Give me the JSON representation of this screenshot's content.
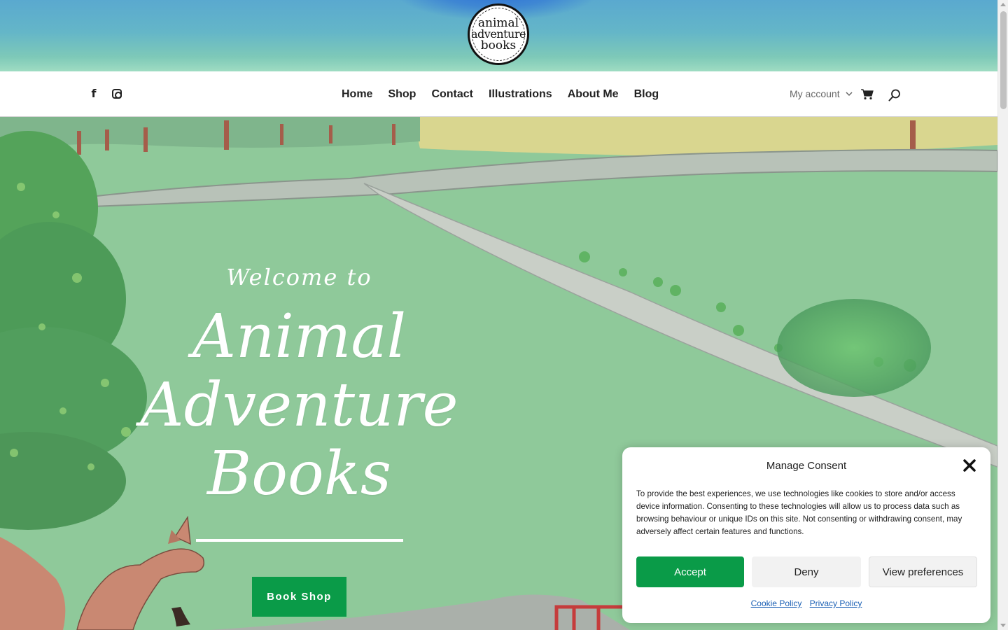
{
  "logo": {
    "line1": "animal",
    "line2": "adventure",
    "line3": "books"
  },
  "nav": {
    "items": [
      {
        "label": "Home"
      },
      {
        "label": "Shop"
      },
      {
        "label": "Contact"
      },
      {
        "label": "Illustrations"
      },
      {
        "label": "About Me"
      },
      {
        "label": "Blog"
      }
    ],
    "account_label": "My account",
    "social": [
      "facebook-icon",
      "instagram-icon"
    ],
    "icons": [
      "chevron-down-icon",
      "cart-icon",
      "search-icon"
    ]
  },
  "hero": {
    "welcome": "Welcome to",
    "title_line1": "Animal",
    "title_line2": "Adventure",
    "title_line3": "Books",
    "button_label": "Book Shop"
  },
  "consent": {
    "title": "Manage Consent",
    "body": "To provide the best experiences, we use technologies like cookies to store and/or access device information. Consenting to these technologies will allow us to process data such as browsing behaviour or unique IDs on this site. Not consenting or withdrawing consent, may adversely affect certain features and functions.",
    "accept": "Accept",
    "deny": "Deny",
    "preferences": "View preferences",
    "cookie_policy": "Cookie Policy",
    "privacy_policy": "Privacy Policy"
  },
  "colors": {
    "accent_green": "#0a9b48",
    "hero_green": "#8fc99a",
    "banner_blue": "#5aa9cf"
  }
}
